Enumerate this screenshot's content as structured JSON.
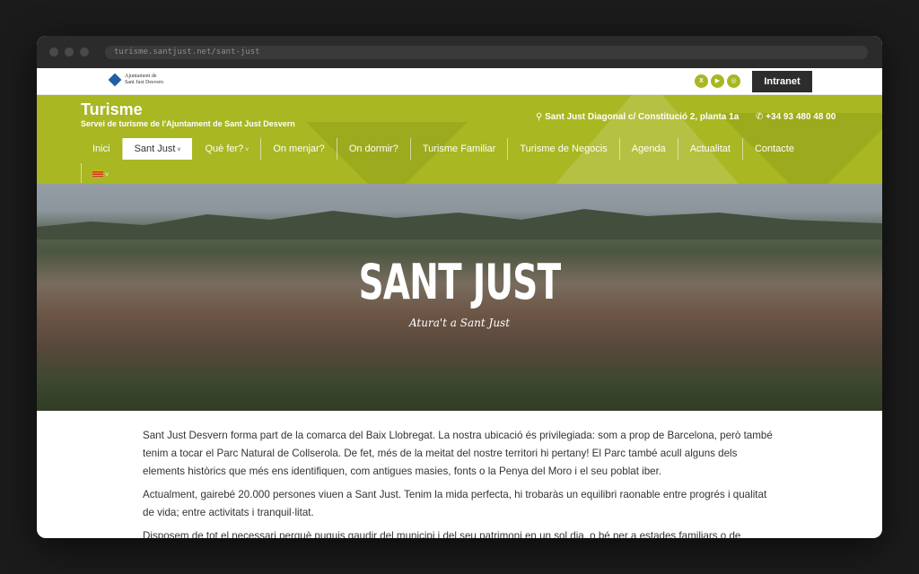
{
  "browser": {
    "url": "turisme.santjust.net/sant-just"
  },
  "topbar": {
    "logo_line1": "Ajuntament de",
    "logo_line2": "Sant Just Desvern",
    "social": [
      {
        "icon": "x-icon",
        "glyph": "X"
      },
      {
        "icon": "youtube-icon",
        "glyph": "▶"
      },
      {
        "icon": "instagram-icon",
        "glyph": "◎"
      }
    ],
    "intranet_label": "Intranet"
  },
  "header": {
    "title": "Turisme",
    "subtitle": "Servei de turisme de l'Ajuntament de Sant Just Desvern",
    "address": "Sant Just Diagonal c/ Constitució 2, planta 1a",
    "phone": "+34 93 480 48 00",
    "nav": [
      {
        "label": "Inici"
      },
      {
        "label": "Sant Just",
        "active": true,
        "dropdown": true
      },
      {
        "label": "Què fer?",
        "dropdown": true
      },
      {
        "label": "On menjar?"
      },
      {
        "label": "On dormir?"
      },
      {
        "label": "Turisme Familiar"
      },
      {
        "label": "Turisme de Negocis"
      },
      {
        "label": "Agenda"
      },
      {
        "label": "Actualitat"
      },
      {
        "label": "Contacte"
      }
    ],
    "accent": "#a8b722"
  },
  "hero": {
    "title": "SANT JUST",
    "tagline": "Atura't a Sant Just"
  },
  "content": {
    "p1": "Sant Just Desvern forma part de la comarca del Baix Llobregat. La nostra ubicació és privilegiada: som a prop de Barcelona, però també tenim a tocar el Parc Natural de Collserola. De fet, més de la meitat del nostre territori hi pertany! El Parc també acull alguns dels elements històrics que més ens identifiquen, com antigues masies, fonts o la Penya del Moro i el seu poblat iber.",
    "p2": "Actualment, gairebé 20.000 persones viuen a Sant Just. Tenim la mida perfecta, hi trobaràs un equilibri raonable entre progrés i qualitat de vida; entre activitats i tranquil·litat.",
    "p3": "Disposem de tot el necessari perquè puguis gaudir del municipi i del seu patrimoni en un sol dia, o bé per a estades familiars o de negocis."
  }
}
